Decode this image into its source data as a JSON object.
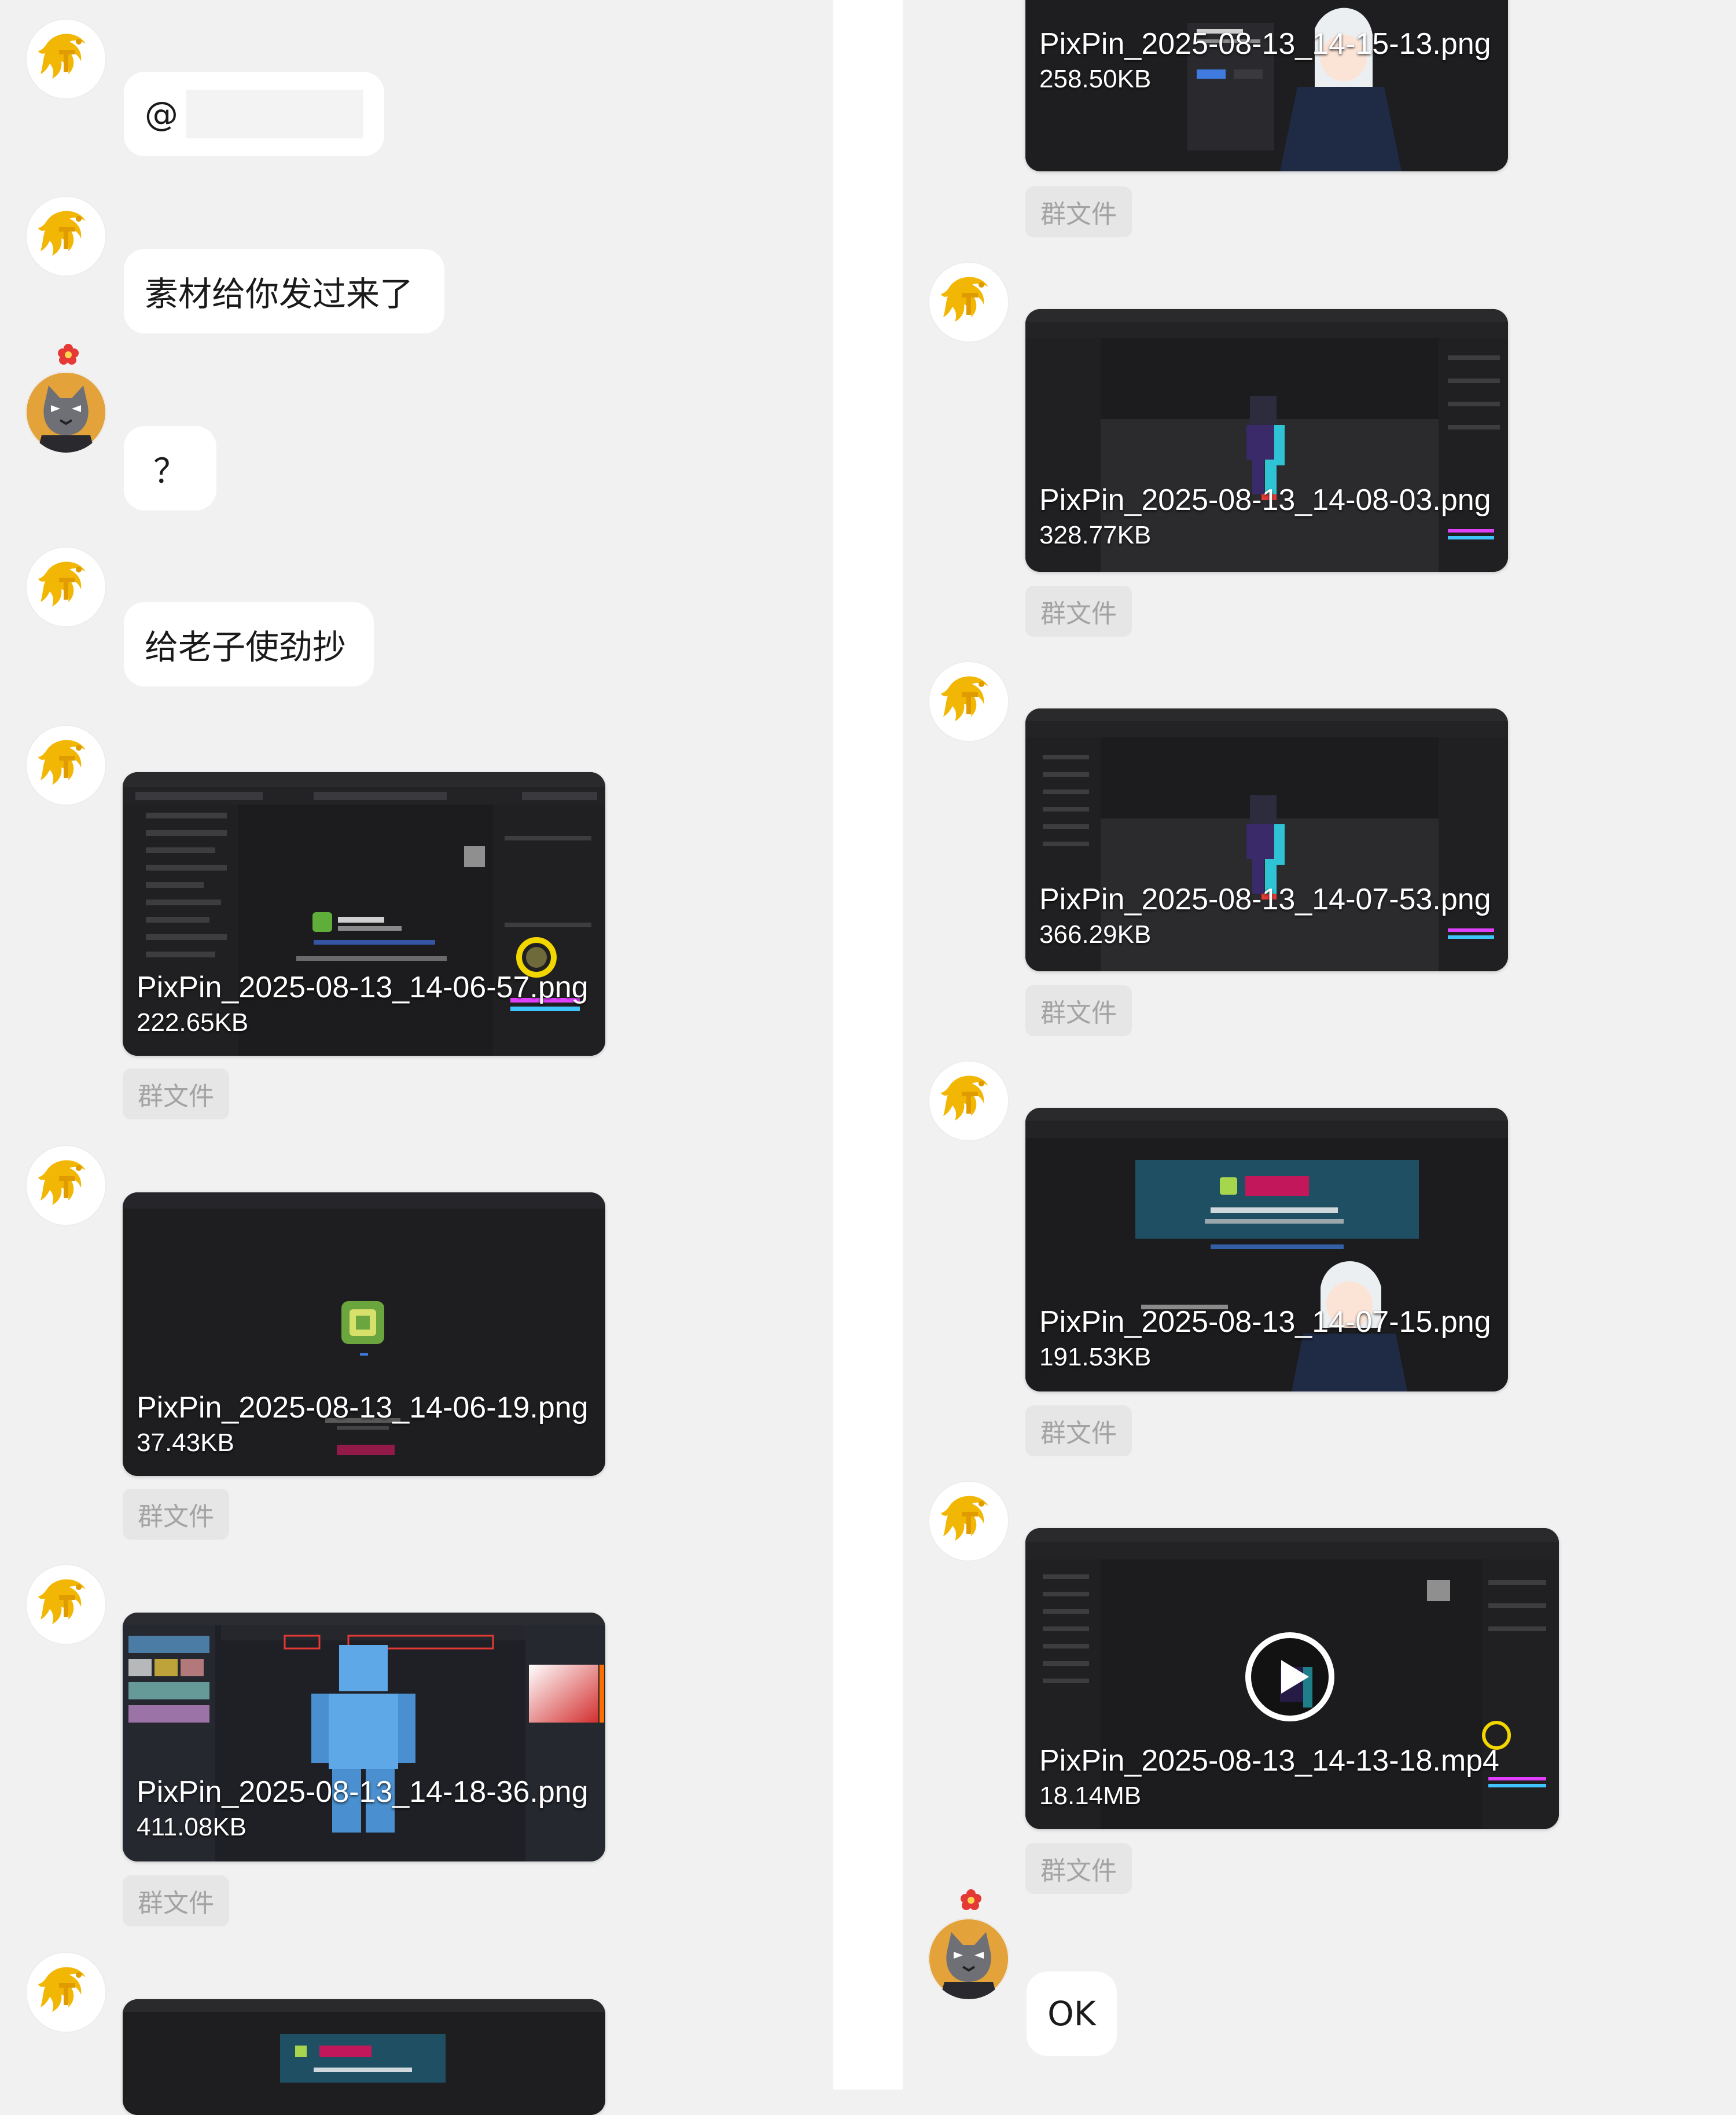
{
  "colors": {
    "background": "#f1f1f1",
    "bubble": "#ffffff",
    "tag_bg": "#e6e6e6",
    "tag_text": "#a3a3a3",
    "avatar_dragon": "#f2b705",
    "avatar_cat": "#e3a23a"
  },
  "icons": [
    "dragon-avatar-icon",
    "cat-avatar-icon",
    "flower-badge-icon",
    "play-icon",
    "app-logo-icon"
  ],
  "tag_label": "群文件",
  "left_column": {
    "messages": [
      {
        "sender": "dragon",
        "type": "text",
        "text": "@"
      },
      {
        "sender": "dragon",
        "type": "text",
        "text": "素材给你发过来了"
      },
      {
        "sender": "cat",
        "type": "text",
        "text": "？"
      },
      {
        "sender": "dragon",
        "type": "text",
        "text": "给老子使劲抄"
      }
    ],
    "files": [
      {
        "name": "PixPin_2025-08-13_14-06-57.png",
        "size": "222.65KB",
        "tag": "群文件"
      },
      {
        "name": "PixPin_2025-08-13_14-06-19.png",
        "size": "37.43KB",
        "tag": "群文件"
      },
      {
        "name": "PixPin_2025-08-13_14-18-36.png",
        "size": "411.08KB",
        "tag": "群文件"
      }
    ]
  },
  "right_column": {
    "files": [
      {
        "name": "PixPin_2025-08-13_14-15-13.png",
        "size": "258.50KB",
        "tag": "群文件"
      },
      {
        "name": "PixPin_2025-08-13_14-08-03.png",
        "size": "328.77KB",
        "tag": "群文件"
      },
      {
        "name": "PixPin_2025-08-13_14-07-53.png",
        "size": "366.29KB",
        "tag": "群文件"
      },
      {
        "name": "PixPin_2025-08-13_14-07-15.png",
        "size": "191.53KB",
        "tag": "群文件"
      },
      {
        "name": "PixPin_2025-08-13_14-13-18.mp4",
        "size": "18.14MB",
        "tag": "群文件"
      }
    ],
    "messages": [
      {
        "sender": "cat",
        "type": "text",
        "text": "OK"
      }
    ]
  }
}
